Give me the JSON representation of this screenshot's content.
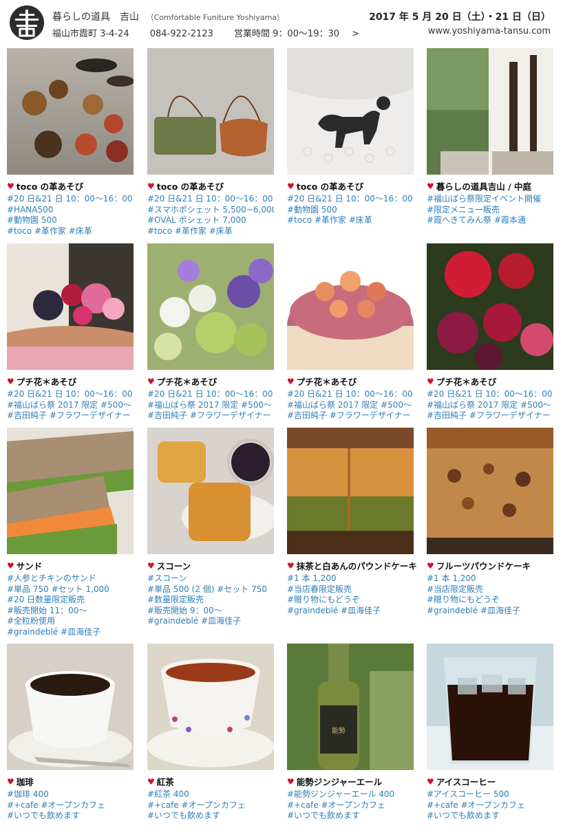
{
  "header": {
    "shop_name": "暮らしの道具　吉山",
    "shop_name_en": "（Comfortable Funiture Yoshiyama）",
    "address": "福山市霞町 3-4-24",
    "phone": "084-922-2123",
    "hours": "営業時間 9：00〜19：30",
    "chevron": ">",
    "date": "2017 年 5 月 20 日（土）・21 日（日）",
    "website": "www.yoshiyama-tansu.com"
  },
  "cards": [
    {
      "title": "toco の革あそび",
      "tags": [
        "#20 日&21 日 10：00〜16：00",
        "#HANA500",
        "#動物園 500",
        "#toco #革作家 #床革"
      ],
      "photo": "leather-craft-photo"
    },
    {
      "title": "toco の革あそび",
      "tags": [
        "#20 日&21 日 10：00〜16：00",
        "#スマホポシェット 5,500~6,000",
        "#OVAL ポシェット 7,000",
        "#toco #革作家 #床革"
      ],
      "photo": "leather-bags-photo"
    },
    {
      "title": "toco の革あそび",
      "tags": [
        "#20 日&21 日 10：00〜16：00",
        "#動物園 500",
        "#toco #革作家 #床革"
      ],
      "photo": "poodle-brooch-photo"
    },
    {
      "title": "暮らしの道具吉山 / 中庭",
      "tags": [
        "#福山ばら祭限定イベント開催",
        "#限定メニュー販売",
        "#霞へきてみん祭 #霞本通"
      ],
      "photo": "courtyard-photo"
    },
    {
      "title": "プチ花＊あそび",
      "tags": [
        "#20 日&21 日 10：00〜16：00",
        "#福山ばら祭 2017 限定 #500〜",
        "#吉田純子 #フラワーデザイナー"
      ],
      "photo": "flower-arrangement-photo-1"
    },
    {
      "title": "プチ花＊あそび",
      "tags": [
        "#20 日&21 日 10：00〜16：00",
        "#福山ばら祭 2017 限定 #500〜",
        "#吉田純子 #フラワーデザイナー"
      ],
      "photo": "flower-arrangement-photo-2"
    },
    {
      "title": "プチ花＊あそび",
      "tags": [
        "#20 日&21 日 10：00〜16：00",
        "#福山ばら祭 2017 限定 #500〜",
        "#吉田純子 #フラワーデザイナー"
      ],
      "photo": "flower-cake-photo"
    },
    {
      "title": "プチ花＊あそび",
      "tags": [
        "#20 日&21 日 10：00〜16：00",
        "#福山ばら祭 2017 限定 #500〜",
        "#吉田純子 #フラワーデザイナー"
      ],
      "photo": "red-flowers-photo"
    },
    {
      "title": "サンド",
      "tags": [
        "#人参とチキンのサンド",
        "#単品 750 #セット 1,000",
        "#20 日数量限定販売",
        "#販売開始 11：00〜",
        "#全粒粉使用",
        "#graindeblé #皿海佳子"
      ],
      "photo": "sandwich-photo"
    },
    {
      "title": "スコーン",
      "tags": [
        "#スコーン",
        "#単品 500 (2 個) #セット 750",
        "#数量限定販売",
        "#販売開始 9：00〜",
        "#graindeblé #皿海佳子"
      ],
      "photo": "scone-photo"
    },
    {
      "title": "抹茶と白あんのパウンドケーキ",
      "tags": [
        "#1 本 1,200",
        "#当店春限定販売",
        "#贈り物にもどうぞ",
        "#graindeblé #皿海佳子"
      ],
      "photo": "matcha-pound-cake-photo"
    },
    {
      "title": "フルーツパウンドケーキ",
      "tags": [
        "#1 本 1,200",
        "#当店限定販売",
        "#贈り物にもどうぞ",
        "#graindeblé #皿海佳子"
      ],
      "photo": "fruit-pound-cake-photo"
    },
    {
      "title": "珈琲",
      "tags": [
        "#珈琲 400",
        "#+cafe #オープンカフェ",
        "#いつでも飲めます"
      ],
      "photo": "coffee-photo"
    },
    {
      "title": "紅茶",
      "tags": [
        "#紅茶 400",
        "#+cafe #オープンカフェ",
        "#いつでも飲めます"
      ],
      "photo": "tea-photo"
    },
    {
      "title": "能勢ジンジャーエール",
      "tags": [
        "#能勢ジンジャーエール 400",
        "#+cafe #オープンカフェ",
        "#いつでも飲めます"
      ],
      "photo": "ginger-ale-photo"
    },
    {
      "title": "アイスコーヒー",
      "tags": [
        "#アイスコーヒー 500",
        "#+cafe #オープンカフェ",
        "#いつでも飲めます"
      ],
      "photo": "iced-coffee-photo"
    }
  ]
}
